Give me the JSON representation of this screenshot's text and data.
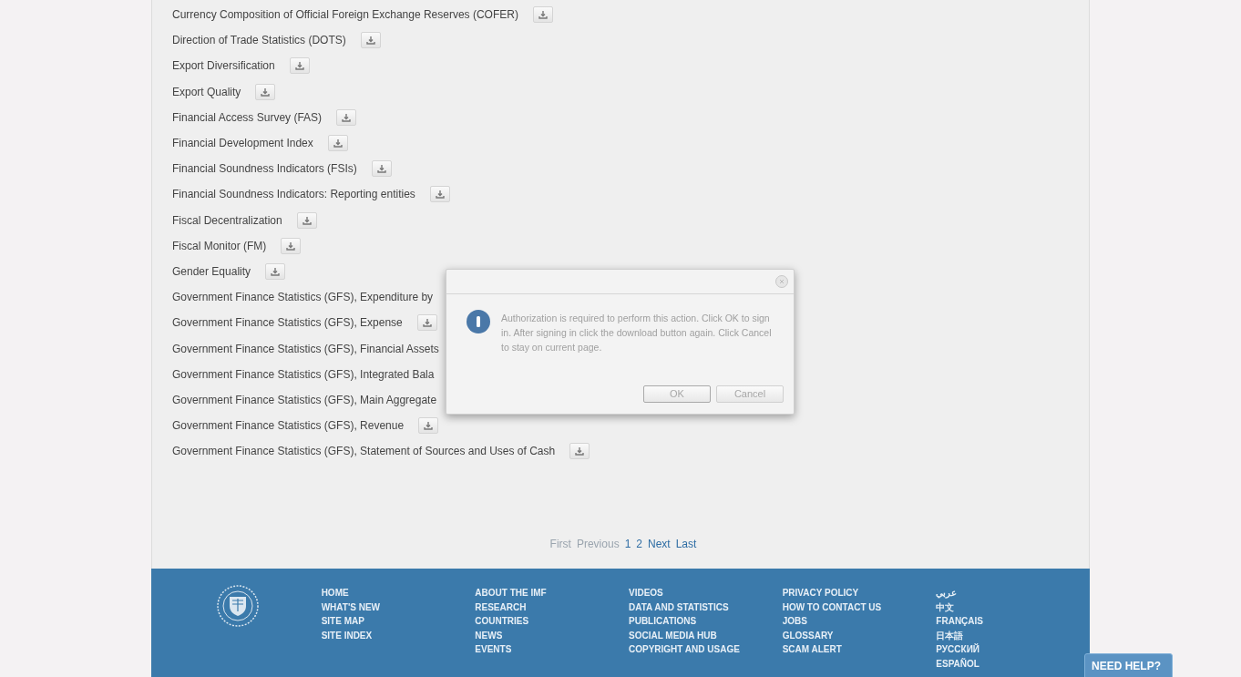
{
  "datasets": [
    {
      "label": "Currency Composition of Official Foreign Exchange Reserves (COFER)",
      "download_button": true
    },
    {
      "label": "Direction of Trade Statistics (DOTS)",
      "download_button": true
    },
    {
      "label": "Export Diversification",
      "download_button": true
    },
    {
      "label": "Export Quality",
      "download_button": true
    },
    {
      "label": "Financial Access Survey (FAS)",
      "download_button": true
    },
    {
      "label": "Financial Development Index",
      "download_button": true
    },
    {
      "label": "Financial Soundness Indicators (FSIs)",
      "download_button": true
    },
    {
      "label": "Financial Soundness Indicators: Reporting entities",
      "download_button": true
    },
    {
      "label": "Fiscal Decentralization",
      "download_button": true
    },
    {
      "label": "Fiscal Monitor (FM)",
      "download_button": true
    },
    {
      "label": "Gender Equality",
      "download_button": true
    },
    {
      "label": "Government Finance Statistics (GFS), Expenditure by",
      "download_button": false
    },
    {
      "label": "Government Finance Statistics (GFS), Expense",
      "download_button": true
    },
    {
      "label": "Government Finance Statistics (GFS), Financial Assets",
      "download_button": false
    },
    {
      "label": "Government Finance Statistics (GFS), Integrated Bala",
      "download_button": false
    },
    {
      "label": "Government Finance Statistics (GFS), Main Aggregate",
      "download_button": false
    },
    {
      "label": "Government Finance Statistics (GFS), Revenue",
      "download_button": true
    },
    {
      "label": "Government Finance Statistics (GFS), Statement of Sources and Uses of Cash",
      "download_button": true
    }
  ],
  "pagination": [
    {
      "label": "First",
      "disabled": true
    },
    {
      "label": "Previous",
      "disabled": true
    },
    {
      "label": "1",
      "disabled": false
    },
    {
      "label": "2",
      "disabled": false
    },
    {
      "label": "Next",
      "disabled": false
    },
    {
      "label": "Last",
      "disabled": false
    }
  ],
  "footer": {
    "columns": [
      [
        "HOME",
        "WHAT'S NEW",
        "SITE MAP",
        "SITE INDEX"
      ],
      [
        "ABOUT THE IMF",
        "RESEARCH",
        "COUNTRIES",
        "NEWS",
        "EVENTS"
      ],
      [
        "VIDEOS",
        "DATA AND STATISTICS",
        "PUBLICATIONS",
        "SOCIAL MEDIA HUB",
        "COPYRIGHT AND USAGE"
      ],
      [
        "PRIVACY POLICY",
        "HOW TO CONTACT US",
        "JOBS",
        "GLOSSARY",
        "SCAM ALERT"
      ],
      [
        "عربي",
        "中文",
        "FRANÇAIS",
        "日本語",
        "РУССКИЙ",
        "ESPAÑOL"
      ]
    ]
  },
  "help_button": "NEED HELP?",
  "dialog": {
    "message": "Authorization is required to perform this action. Click OK to sign in. After signing in click the download button again. Click Cancel to stay on current page.",
    "buttons": [
      "OK",
      "Cancel"
    ]
  }
}
